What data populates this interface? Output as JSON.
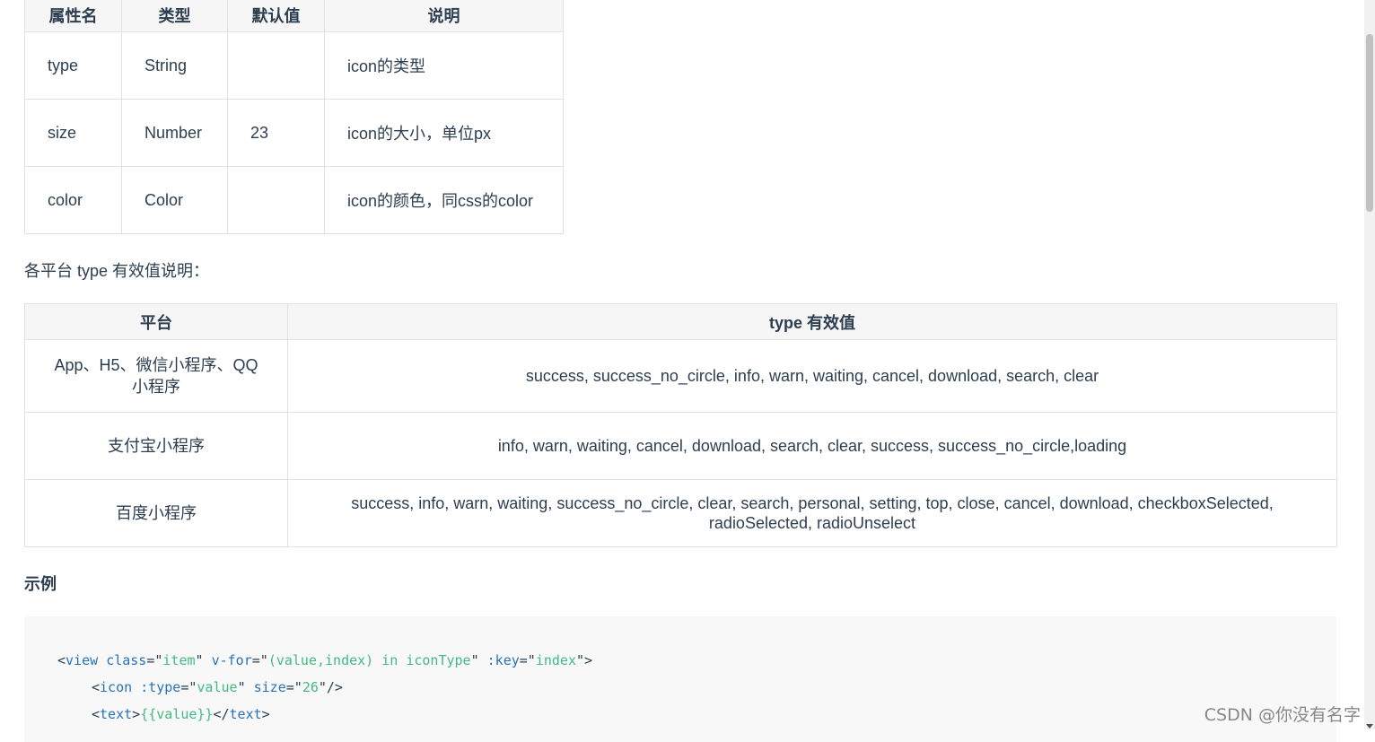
{
  "props_table": {
    "headers": [
      "属性名",
      "类型",
      "默认值",
      "说明"
    ],
    "rows": [
      [
        "type",
        "String",
        "",
        "icon的类型"
      ],
      [
        "size",
        "Number",
        "23",
        "icon的大小，单位px"
      ],
      [
        "color",
        "Color",
        "",
        "icon的颜色，同css的color"
      ]
    ]
  },
  "platform_intro": "各平台 type 有效值说明：",
  "platform_table": {
    "headers": [
      "平台",
      "type 有效值"
    ],
    "rows": [
      [
        "App、H5、微信小程序、QQ小程序",
        "success, success_no_circle, info, warn, waiting, cancel, download, search, clear"
      ],
      [
        "支付宝小程序",
        "info, warn, waiting, cancel, download, search, clear, success, success_no_circle,loading"
      ],
      [
        "百度小程序",
        "success, info, warn, waiting, success_no_circle, clear, search, personal, setting, top, close, cancel, download, checkboxSelected, radioSelected, radioUnselect"
      ]
    ]
  },
  "example_heading": "示例",
  "code": {
    "line1": {
      "open": "<",
      "tag": "view",
      "attr1": "class",
      "eq1": "=\"",
      "val1": "item",
      "q1": "\"",
      "attr2": "v-for",
      "eq2": "=\"",
      "val2": "(value,index) in iconType",
      "q2": "\"",
      "attr3": ":key",
      "eq3": "=\"",
      "val3": "index",
      "close": "\">"
    },
    "line2": {
      "open": "<",
      "tag": "icon",
      "attr1": ":type",
      "eq1": "=\"",
      "val1": "value",
      "q1": "\"",
      "attr2": "size",
      "eq2": "=\"",
      "val2": "26",
      "close": "\"/>"
    },
    "line3": {
      "open": "<",
      "tag": "text",
      "gt": ">",
      "expr": "{{value}}",
      "end_open": "</",
      "end_tag": "text",
      "end_close": ">"
    }
  },
  "watermark": "CSDN @你没有名字"
}
